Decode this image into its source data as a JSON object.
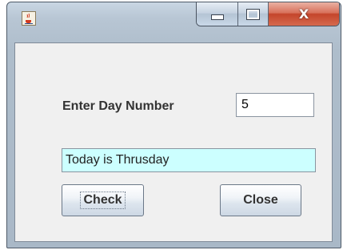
{
  "window": {
    "controls": {
      "close_glyph": "X"
    }
  },
  "form": {
    "day_label": "Enter Day Number",
    "day_value": "5",
    "result_text": "Today is Thrusday",
    "result_bg": "#ccffff"
  },
  "buttons": {
    "check_label": "Check",
    "close_label": "Close"
  }
}
